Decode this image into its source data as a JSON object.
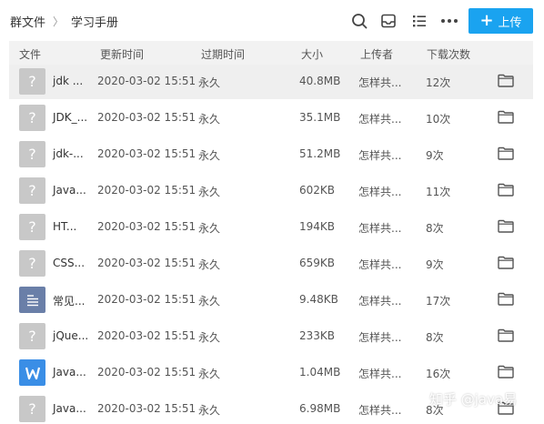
{
  "breadcrumb": {
    "root": "群文件",
    "separator": "〉",
    "current": "学习手册"
  },
  "toolbar": {
    "upload_label": "上传",
    "upload_plus": "+"
  },
  "columns": [
    "文件",
    "更新时间",
    "过期时间",
    "大小",
    "上传者",
    "下载次数"
  ],
  "files": [
    {
      "name": "jdk ...",
      "icon": "unknown-file",
      "updated": "2020-03-02 15:51",
      "expires": "永久",
      "size": "40.8MB",
      "uploader": "怎样共...",
      "downloads": "12次",
      "selected": true
    },
    {
      "name": "JDK_...",
      "icon": "unknown-file",
      "updated": "2020-03-02 15:51",
      "expires": "永久",
      "size": "35.1MB",
      "uploader": "怎样共...",
      "downloads": "10次"
    },
    {
      "name": "jdk-...",
      "icon": "unknown-file",
      "updated": "2020-03-02 15:51",
      "expires": "永久",
      "size": "51.2MB",
      "uploader": "怎样共...",
      "downloads": "9次"
    },
    {
      "name": "Java...",
      "icon": "unknown-file",
      "updated": "2020-03-02 15:51",
      "expires": "永久",
      "size": "602KB",
      "uploader": "怎样共...",
      "downloads": "11次"
    },
    {
      "name": "HT...",
      "icon": "unknown-file",
      "updated": "2020-03-02 15:51",
      "expires": "永久",
      "size": "194KB",
      "uploader": "怎样共...",
      "downloads": "8次"
    },
    {
      "name": "CSS...",
      "icon": "unknown-file",
      "updated": "2020-03-02 15:51",
      "expires": "永久",
      "size": "659KB",
      "uploader": "怎样共...",
      "downloads": "9次"
    },
    {
      "name": "常见...",
      "icon": "document-file",
      "updated": "2020-03-02 15:51",
      "expires": "永久",
      "size": "9.48KB",
      "uploader": "怎样共...",
      "downloads": "17次"
    },
    {
      "name": "jQue...",
      "icon": "unknown-file",
      "updated": "2020-03-02 15:51",
      "expires": "永久",
      "size": "233KB",
      "uploader": "怎样共...",
      "downloads": "8次"
    },
    {
      "name": "Java...",
      "icon": "word-file",
      "updated": "2020-03-02 15:51",
      "expires": "永久",
      "size": "1.04MB",
      "uploader": "怎样共...",
      "downloads": "16次"
    },
    {
      "name": "Java...",
      "icon": "unknown-file",
      "updated": "2020-03-02 15:51",
      "expires": "永久",
      "size": "6.98MB",
      "uploader": "怎样共...",
      "downloads": "8次"
    }
  ],
  "watermark": "知乎 @java易",
  "colors": {
    "accent": "#1aa3f0",
    "header_bg": "#f2f2f2",
    "selected_row": "#efefef"
  }
}
